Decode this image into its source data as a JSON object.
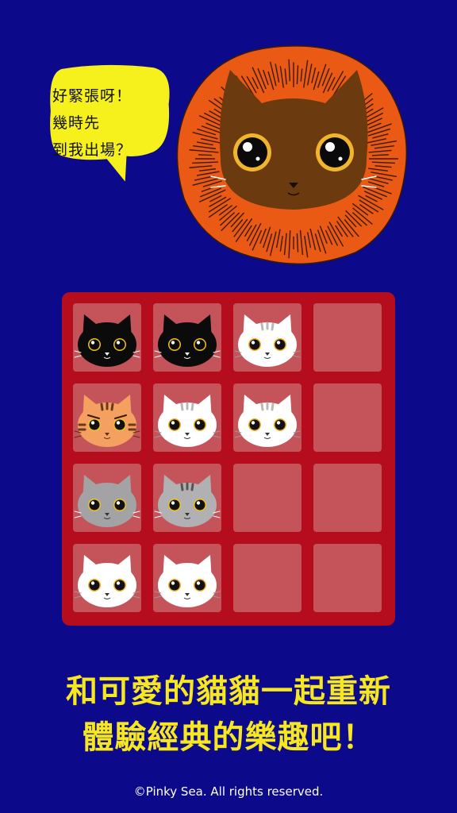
{
  "speech": {
    "lines": [
      "好緊張呀！",
      "幾時先",
      "到我出場？"
    ]
  },
  "board": {
    "rows": 4,
    "cols": 4,
    "cells": [
      [
        "black",
        "black",
        "white-gray-tabby",
        "empty"
      ],
      [
        "orange-tabby",
        "white-gray-tabby",
        "white-gray-tabby",
        "empty"
      ],
      [
        "gray",
        "gray-tabby",
        "empty",
        "empty"
      ],
      [
        "white",
        "white",
        "empty",
        "empty"
      ]
    ]
  },
  "tagline": {
    "line1": "和可愛的貓貓一起重新",
    "line2": "體驗經典的樂趣吧！"
  },
  "footer": {
    "copyright": "©Pinky Sea. All rights reserved."
  },
  "colors": {
    "background": "#0c0a8a",
    "board": "#b50d1d",
    "cell": "#c4545a",
    "tagline": "#f6e71f",
    "bubble": "#f6f01c",
    "hero_mane": "#ea5a14",
    "hero_face": "#6b3a0e"
  }
}
